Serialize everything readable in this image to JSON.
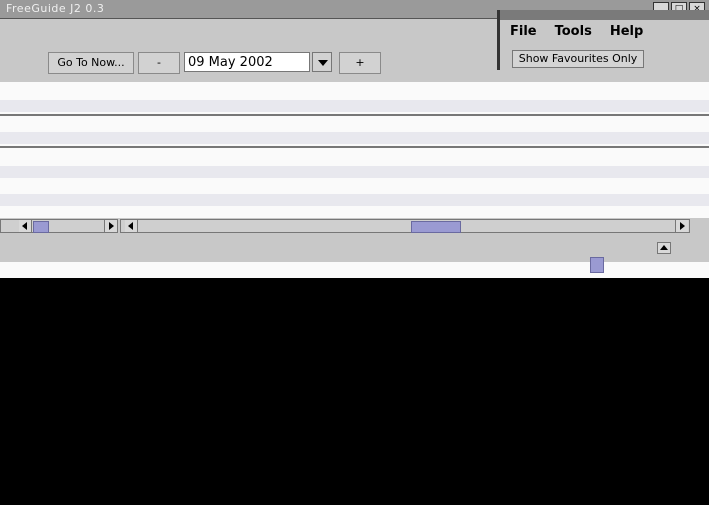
{
  "window": {
    "title": "FreeGuide J2 0.3",
    "controls": [
      "minimize-icon",
      "maximize-icon",
      "close-icon"
    ]
  },
  "menu": {
    "file": "File",
    "tools": "Tools",
    "help": "Help"
  },
  "toolbar": {
    "go_to_now": "Go To Now...",
    "prev_day": "-",
    "date": "09 May 2002",
    "next_day": "+",
    "show_favourites": "Show Favourites Only"
  },
  "colors": {
    "highlight": "#9a9ac8",
    "scroll_thumb": "#9a9ad2",
    "window_bg": "#c8c8c8"
  }
}
